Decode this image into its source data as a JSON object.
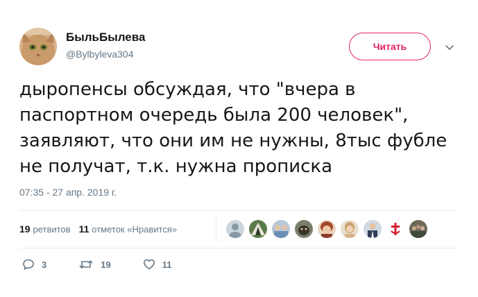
{
  "author": {
    "display_name": "БыльБылева",
    "handle": "@Bylbyleva304"
  },
  "follow_button": {
    "label": "Читать"
  },
  "tweet": {
    "text": "дыропенсы обсуждая, что \"вчера в паспортном очередь была 200 человек\", заявляют, что они им не нужны, 8тыс фубле не получат, т.к. нужна прописка",
    "timestamp": "07:35 - 27 апр. 2019 г."
  },
  "stats": {
    "retweets_count": "19",
    "retweets_label": "ретвитов",
    "likes_count": "11",
    "likes_label": "отметок «Нравится»"
  },
  "likers": [
    {
      "icon": "default-avatar"
    },
    {
      "icon": "tent-avatar"
    },
    {
      "icon": "group-avatar"
    },
    {
      "icon": "dog-avatar"
    },
    {
      "icon": "woman-avatar"
    },
    {
      "icon": "girl-avatar"
    },
    {
      "icon": "man-suit-avatar"
    },
    {
      "icon": "cross-avatar"
    },
    {
      "icon": "crowd-avatar"
    }
  ],
  "actions": {
    "replies": "3",
    "retweets": "19",
    "likes": "11"
  },
  "colors": {
    "accent": "#e0245e",
    "secondary_text": "#657786",
    "primary_text": "#14171a",
    "divider": "#e6ecf0"
  }
}
